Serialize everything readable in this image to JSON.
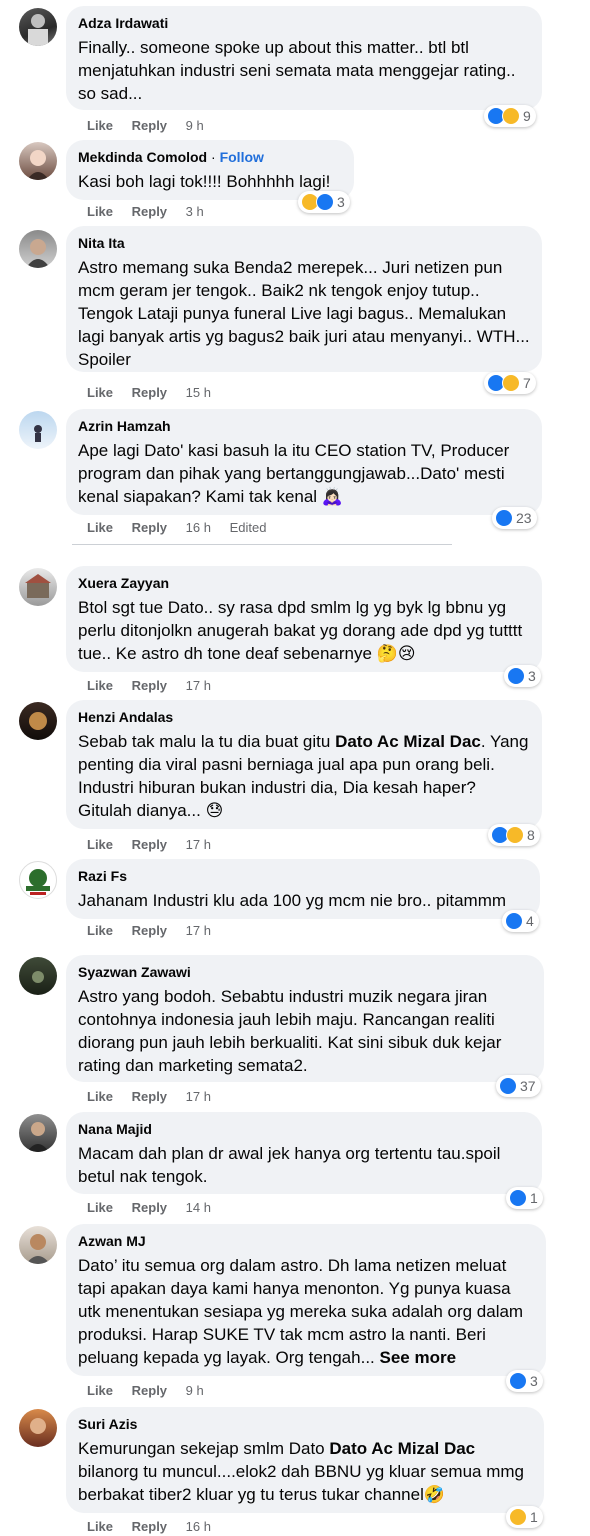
{
  "comments": [
    {
      "author": "Adza Irdawati",
      "text": "Finally.. someone spoke up about this matter.. btl btl menjatuhkan industri seni semata mata menggejar rating.. so sad...",
      "like": "Like",
      "reply": "Reply",
      "time": "9 h",
      "count": "9"
    },
    {
      "author": "Mekdinda Comolod",
      "follow": "Follow",
      "text": "Kasi boh lagi tok!!!! Bohhhhh lagi!",
      "like": "Like",
      "reply": "Reply",
      "time": "3 h",
      "count": "3"
    },
    {
      "author": "Nita Ita",
      "text": "Astro memang suka Benda2 merepek... Juri netizen pun mcm geram jer tengok.. Baik2 nk tengok enjoy tutup.. Tengok Lataji punya funeral Live lagi bagus.. Memalukan lagi banyak artis yg bagus2 baik juri atau menyanyi.. WTH... Spoiler",
      "like": "Like",
      "reply": "Reply",
      "time": "15 h",
      "count": "7"
    },
    {
      "author": "Azrin Hamzah",
      "text": "Ape lagi Dato' kasi basuh la itu CEO station TV, Producer program dan pihak yang bertanggungjawab...Dato' mesti kenal siapakan? Kami tak kenal 🙇🏻‍♀️",
      "like": "Like",
      "reply": "Reply",
      "time": "16 h",
      "edited": "Edited",
      "count": "23"
    },
    {
      "author": "Xuera Zayyan",
      "text": "Btol sgt tue Dato.. sy rasa dpd smlm lg yg byk lg bbnu yg perlu ditonjolkn anugerah bakat yg dorang ade dpd yg tutttt tue.. Ke astro dh tone deaf sebenarnye 🤔😢",
      "like": "Like",
      "reply": "Reply",
      "time": "17 h",
      "count": "3"
    },
    {
      "author": "Henzi Andalas",
      "text_a": "Sebab tak malu la tu dia buat gitu ",
      "mention": "Dato Ac Mizal Dac",
      "text_b": ". Yang penting dia viral pasni berniaga jual apa pun orang beli. Industri hiburan bukan industri dia, Dia kesah haper? Gitulah dianya... 😓",
      "like": "Like",
      "reply": "Reply",
      "time": "17 h",
      "count": "8"
    },
    {
      "author": "Razi Fs",
      "text": "Jahanam Industri klu ada 100 yg mcm nie bro.. pitammm",
      "like": "Like",
      "reply": "Reply",
      "time": "17 h",
      "count": "4"
    },
    {
      "author": "Syazwan Zawawi",
      "text": "Astro yang bodoh. Sebabtu industri muzik negara jiran contohnya indonesia jauh lebih maju. Rancangan realiti diorang pun jauh lebih berkualiti. Kat sini sibuk duk kejar rating dan marketing semata2.",
      "like": "Like",
      "reply": "Reply",
      "time": "17 h",
      "count": "37"
    },
    {
      "author": "Nana Majid",
      "text": "Macam dah plan dr awal jek hanya org tertentu tau.spoil betul nak tengok.",
      "like": "Like",
      "reply": "Reply",
      "time": "14 h",
      "count": "1"
    },
    {
      "author": "Azwan MJ",
      "text": "Dato’ itu semua org dalam astro. Dh lama netizen meluat tapi apakan daya kami hanya menonton. Yg punya kuasa utk menentukan sesiapa yg mereka suka adalah org dalam produksi. Harap SUKE TV tak mcm astro la nanti. Beri peluang kepada yg layak. Org tengah... ",
      "see_more": "See more",
      "like": "Like",
      "reply": "Reply",
      "time": "9 h",
      "count": "3"
    },
    {
      "author": "Suri Azis",
      "text_a": "Kemurungan sekejap smlm Dato ",
      "mention": "Dato Ac Mizal Dac",
      "text_b": " bilanorg tu muncul....elok2 dah BBNU yg kluar semua mmg berbakat tiber2 kluar yg tu terus tukar channel🤣",
      "like": "Like",
      "reply": "Reply",
      "time": "16 h",
      "count": "1"
    }
  ],
  "colors": {
    "bubble": "#f0f2f5",
    "link": "#216fdb",
    "meta": "#65676b",
    "like": "#1877f2",
    "haha": "#f7b928"
  },
  "icons": [
    "like-reaction-icon",
    "haha-reaction-icon"
  ]
}
